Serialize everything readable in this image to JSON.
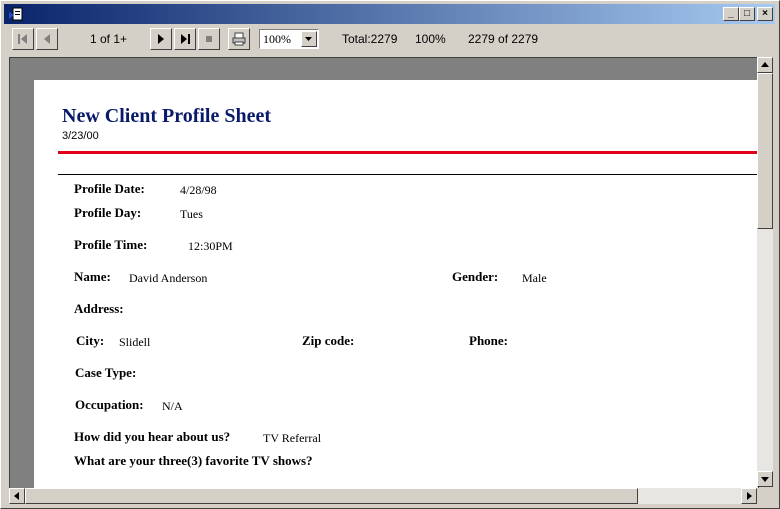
{
  "window": {
    "minimize_label": "_",
    "maximize_label": "□",
    "close_label": "×"
  },
  "toolbar": {
    "page_indicator": "1 of 1+",
    "zoom_value": "100%",
    "total": "Total:2279",
    "percent": "100%",
    "records": "2279 of 2279"
  },
  "report": {
    "title": "New Client Profile Sheet",
    "date": "3/23/00",
    "fields": {
      "profile_date_label": "Profile Date:",
      "profile_date_value": "4/28/98",
      "profile_day_label": "Profile Day:",
      "profile_day_value": "Tues",
      "profile_time_label": "Profile Time:",
      "profile_time_value": "12:30PM",
      "name_label": "Name:",
      "name_value": "David  Anderson",
      "gender_label": "Gender:",
      "gender_value": "Male",
      "address_label": "Address:",
      "city_label": "City:",
      "city_value": "Slidell",
      "zip_label": "Zip code:",
      "phone_label": "Phone:",
      "case_type_label": "Case Type:",
      "occupation_label": "Occupation:",
      "occupation_value": "N/A",
      "hear_label": "How did you hear about us?",
      "hear_value": "TV Referral",
      "tv_label": "What are your three(3) favorite TV shows?"
    }
  },
  "colors": {
    "title_text": "#0a1a6a",
    "rule_red": "#e0001a",
    "titlebar_start": "#0a246a",
    "titlebar_end": "#a6caf0"
  }
}
